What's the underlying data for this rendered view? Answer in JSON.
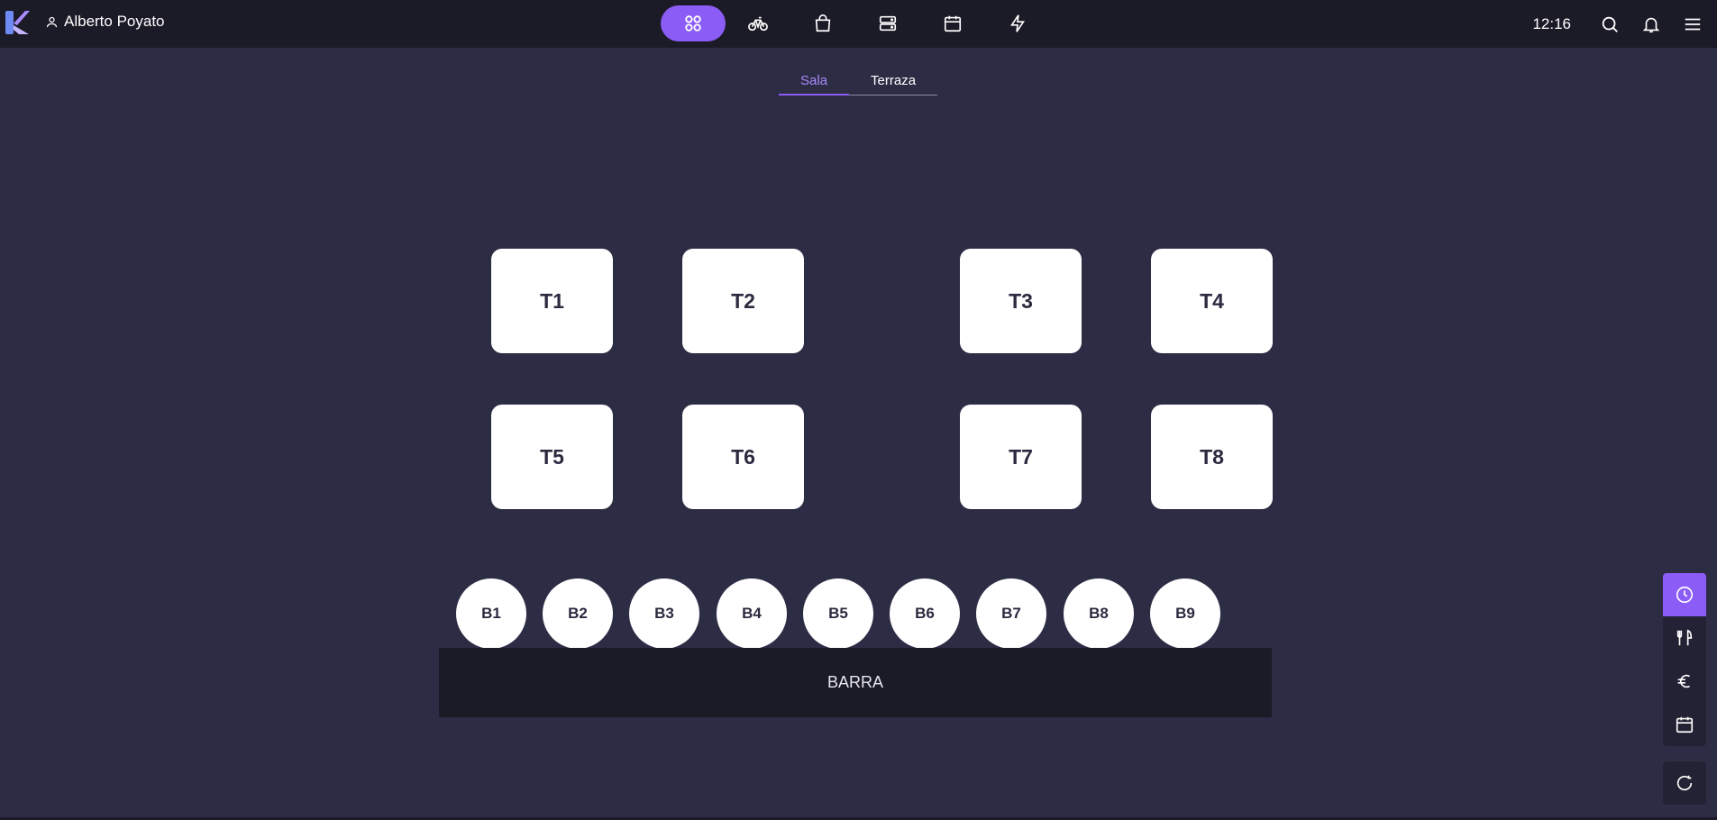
{
  "header": {
    "user_name": "Alberto Poyato",
    "time": "12:16"
  },
  "tabs": [
    {
      "label": "Sala",
      "active": true
    },
    {
      "label": "Terraza",
      "active": false
    }
  ],
  "tables": [
    "T1",
    "T2",
    "T3",
    "T4",
    "T5",
    "T6",
    "T7",
    "T8"
  ],
  "stools": [
    "B1",
    "B2",
    "B3",
    "B4",
    "B5",
    "B6",
    "B7",
    "B8",
    "B9"
  ],
  "bar_label": "BARRA",
  "colors": {
    "accent": "#8b5cf6",
    "background": "#2d2c45",
    "topbar": "#1b1a27"
  },
  "nav_icons": [
    "grid-icon",
    "bicycle-icon",
    "shopping-bag-icon",
    "server-icon",
    "calendar-icon",
    "lightning-icon"
  ],
  "side_icons": [
    "clock-icon",
    "utensils-icon",
    "euro-icon",
    "calendar-icon",
    "refresh-icon"
  ]
}
